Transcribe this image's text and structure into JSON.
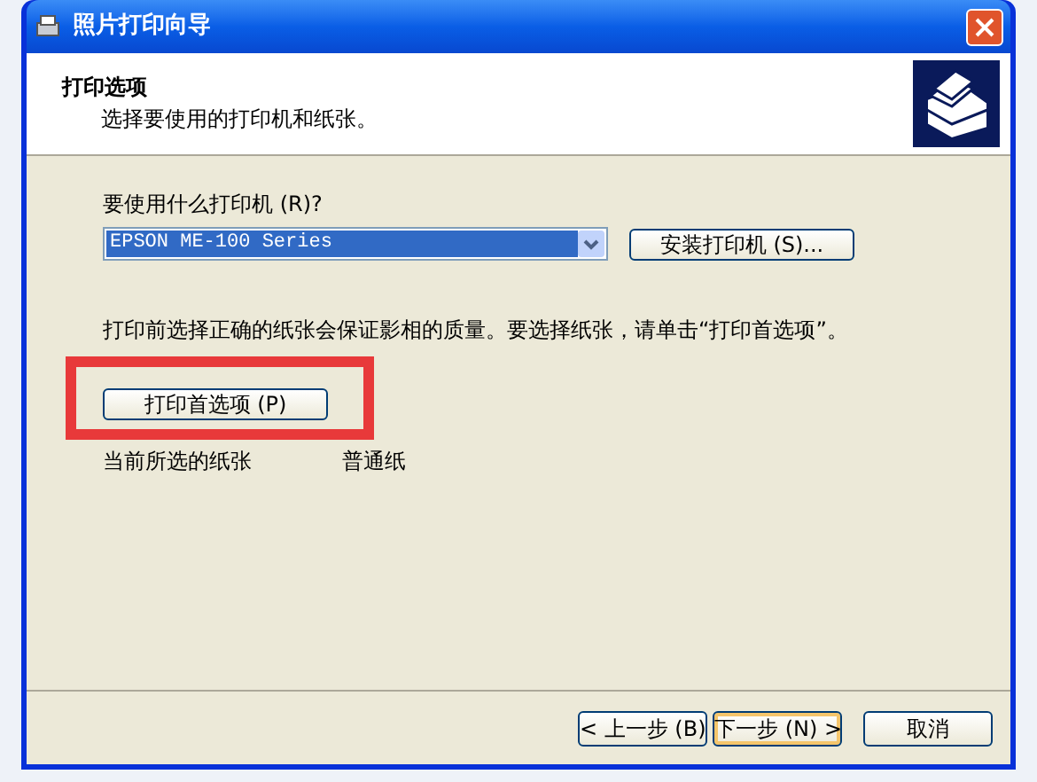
{
  "window": {
    "title": "照片打印向导"
  },
  "header": {
    "title": "打印选项",
    "subtitle": "选择要使用的打印机和纸张。"
  },
  "printer": {
    "label": "要使用什么打印机 (R)?",
    "value": "EPSON ME-100 Series",
    "install_button": "安装打印机 (S)..."
  },
  "hint": "打印前选择正确的纸张会保证影相的质量。要选择纸张，请单击“打印首选项”。",
  "preferences_button": "打印首选项 (P)",
  "paper": {
    "label": "当前所选的纸张",
    "value": "普通纸"
  },
  "buttons": [
    {
      "label": "< 上一步 (B)",
      "default": false
    },
    {
      "label": "下一步 (N) >",
      "default": true
    },
    {
      "label": "取消",
      "default": false
    }
  ]
}
